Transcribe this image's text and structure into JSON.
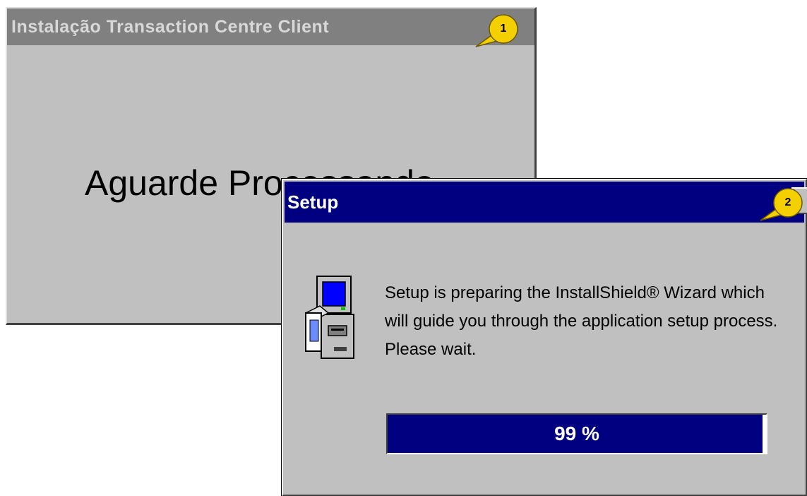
{
  "window1": {
    "title": "Instalação Transaction Centre Client",
    "message": "Aguarde Processando"
  },
  "window2": {
    "title": "Setup",
    "message": "Setup is preparing the InstallShield® Wizard which will guide you through the application setup process.  Please wait.",
    "progress": {
      "percent": 99,
      "label": "99 %"
    }
  },
  "callouts": [
    {
      "label": "1"
    },
    {
      "label": "2"
    }
  ],
  "colors": {
    "active_titlebar": "#000080",
    "inactive_titlebar": "#808080",
    "window_face": "#c0c0c0",
    "callout_fill": "#f5d000"
  }
}
